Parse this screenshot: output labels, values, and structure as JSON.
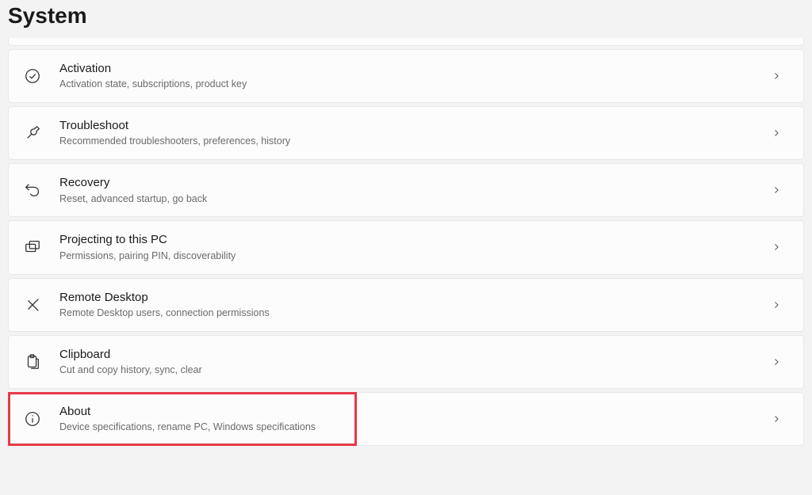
{
  "page_title": "System",
  "items": [
    {
      "icon": "check-circle-icon",
      "title": "Activation",
      "subtitle": "Activation state, subscriptions, product key"
    },
    {
      "icon": "wrench-icon",
      "title": "Troubleshoot",
      "subtitle": "Recommended troubleshooters, preferences, history"
    },
    {
      "icon": "recovery-icon",
      "title": "Recovery",
      "subtitle": "Reset, advanced startup, go back"
    },
    {
      "icon": "projecting-icon",
      "title": "Projecting to this PC",
      "subtitle": "Permissions, pairing PIN, discoverability"
    },
    {
      "icon": "remote-desktop-icon",
      "title": "Remote Desktop",
      "subtitle": "Remote Desktop users, connection permissions"
    },
    {
      "icon": "clipboard-icon",
      "title": "Clipboard",
      "subtitle": "Cut and copy history, sync, clear"
    },
    {
      "icon": "info-icon",
      "title": "About",
      "subtitle": "Device specifications, rename PC, Windows specifications"
    }
  ],
  "highlight_color": "#e63946"
}
